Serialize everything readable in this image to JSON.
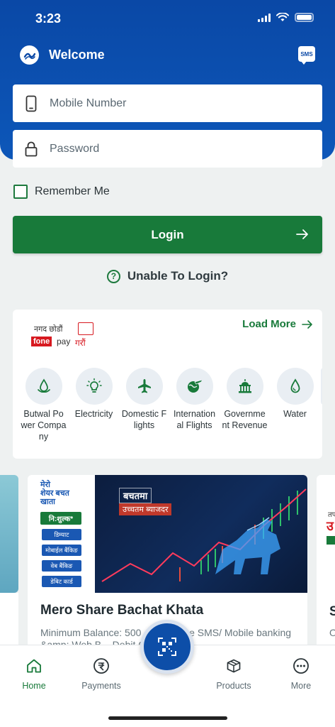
{
  "status_bar": {
    "time": "3:23"
  },
  "header": {
    "title": "Welcome",
    "sms_label": "SMS"
  },
  "login_form": {
    "mobile_placeholder": "Mobile Number",
    "password_placeholder": "Password",
    "remember_label": "Remember Me",
    "login_label": "Login",
    "unable_label": "Unable To Login?"
  },
  "services": {
    "partner_top": "नगद छोडौं",
    "partner_fone": "fone",
    "partner_pay": "pay",
    "partner_garau": "गरौं",
    "load_more": "Load More",
    "items": [
      {
        "label": "Butwal Power Company",
        "icon": "water-drop-hand-icon"
      },
      {
        "label": "Electricity",
        "icon": "bulb-icon"
      },
      {
        "label": "Domestic Flights",
        "icon": "plane-icon"
      },
      {
        "label": "International Flights",
        "icon": "globe-plane-icon"
      },
      {
        "label": "Government Revenue",
        "icon": "government-building-icon"
      },
      {
        "label": "Water",
        "icon": "water-drop-icon"
      }
    ]
  },
  "promo": {
    "logo_line1": "मेरो",
    "logo_line2": "शेयर बचत",
    "logo_line3": "खाता",
    "free_label": "नि:शुल्क*",
    "chips": [
      "डिम्याट",
      "मोबाईल बैंकिङ",
      "वेब बैंकिङ",
      "डेबिट कार्ड"
    ],
    "banner_line1": "बचतमा",
    "banner_line2": "उच्चतम ब्याजदर",
    "title": "Mero Share Bachat Khata",
    "description": "Minimum Balance: 500 ... mat Free SMS/ Mobile banking &amp; Web B... Debit Card",
    "next_card_text1": "तप",
    "next_card_text2": "उ",
    "next_card_title": "S",
    "next_card_desc": "O"
  },
  "bottom_nav": {
    "home": "Home",
    "payments": "Payments",
    "products": "Products",
    "more": "More"
  },
  "colors": {
    "brand_blue": "#0a48a6",
    "brand_green": "#187a3a"
  }
}
